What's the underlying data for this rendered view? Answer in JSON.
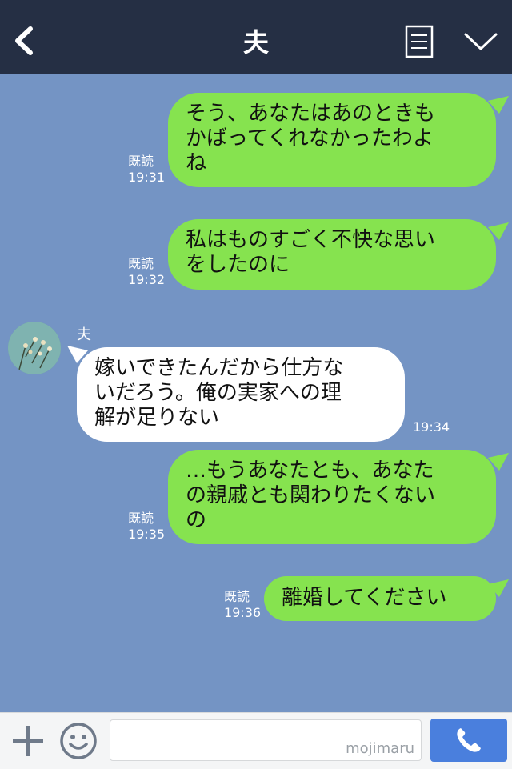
{
  "header": {
    "title": "夫"
  },
  "messages": [
    {
      "side": "me",
      "text": "そう、あなたはあのときも\nかばってくれなかったわよ\nね",
      "read": "既読",
      "time": "19:31"
    },
    {
      "side": "me",
      "text": "私はものすごく不快な思い\nをしたのに",
      "read": "既読",
      "time": "19:32"
    },
    {
      "side": "them",
      "sender": "夫",
      "text": "嫁いできたんだから仕方な\nいだろう。俺の実家への理\n解が足りない",
      "time": "19:34"
    },
    {
      "side": "me",
      "text": "…もうあなたとも、あなた\nの親戚とも関わりたくない\nの",
      "read": "既読",
      "time": "19:35"
    },
    {
      "side": "me",
      "text": "離婚してください",
      "read": "既読",
      "time": "19:36"
    }
  ],
  "footer": {
    "watermark": "mojimaru"
  },
  "colors": {
    "header_bg": "#252f44",
    "chat_bg": "#7494c4",
    "my_bubble": "#86e34f",
    "their_bubble": "#ffffff",
    "call_button": "#4a7fdd"
  },
  "icons": [
    "back-icon",
    "menu-icon",
    "chevron-down-icon",
    "plus-icon",
    "emoji-icon",
    "phone-icon"
  ]
}
